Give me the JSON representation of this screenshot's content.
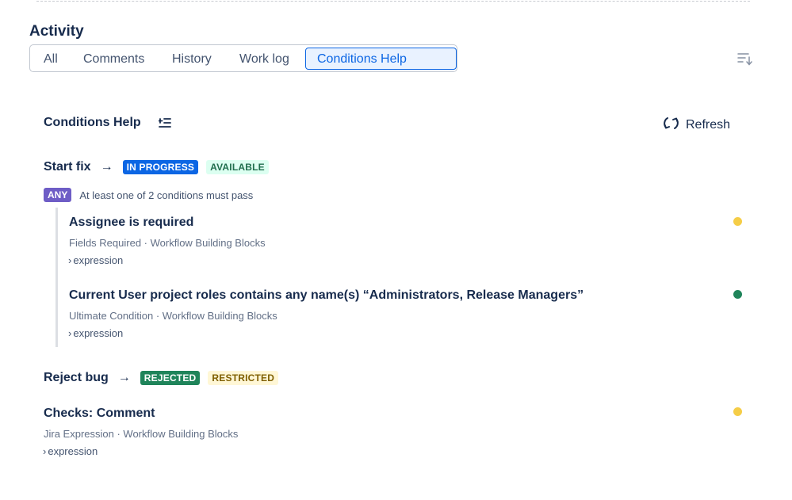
{
  "activity": {
    "title": "Activity",
    "tabs": [
      {
        "label": "All",
        "active": false
      },
      {
        "label": "Comments",
        "active": false
      },
      {
        "label": "History",
        "active": false
      },
      {
        "label": "Work log",
        "active": false
      },
      {
        "label": "Conditions Help",
        "active": true
      }
    ],
    "sort_icon": "sort-icon"
  },
  "panel": {
    "title": "Conditions Help",
    "list_icon": "list-indent-icon",
    "refresh_label": "Refresh",
    "refresh_icon": "refresh-icon"
  },
  "transitions": [
    {
      "name": "Start fix",
      "arrow": "→",
      "status": "IN PROGRESS",
      "availability": "AVAILABLE",
      "mode_badge": "ANY",
      "mode_text": "At least one of 2 conditions must pass",
      "conditions": [
        {
          "title": "Assignee is required",
          "meta": "Fields Required · Workflow Building Blocks",
          "expression_label": "expression",
          "state_color": "#F5CD47"
        },
        {
          "title": "Current User project roles contains any name(s) “Administrators, Release Managers”",
          "meta": "Ultimate Condition · Workflow Building Blocks",
          "expression_label": "expression",
          "state_color": "#1F845A"
        }
      ]
    },
    {
      "name": "Reject bug",
      "arrow": "→",
      "status": "REJECTED",
      "availability": "RESTRICTED",
      "conditions": [
        {
          "title": "Checks: Comment",
          "meta": "Jira Expression · Workflow Building Blocks",
          "expression_label": "expression",
          "state_color": "#F5CD47"
        }
      ]
    }
  ],
  "colors": {
    "accent": "#0C66E4",
    "status_in_progress": "#0C66E4",
    "status_rejected": "#1F845A",
    "available_bg": "#DCFFF1",
    "restricted_bg": "#FFF7D6",
    "any_badge": "#6E5DC6"
  }
}
